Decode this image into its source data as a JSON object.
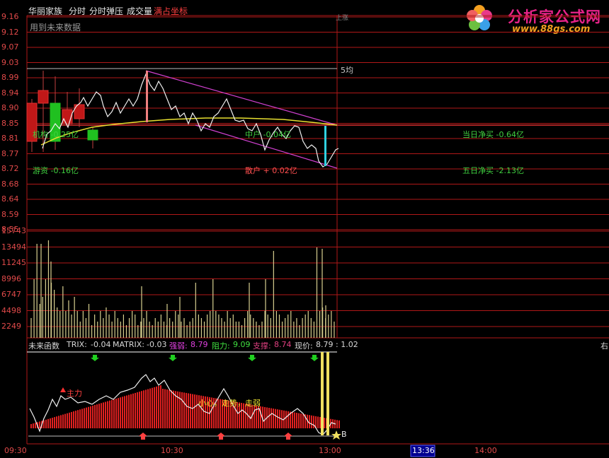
{
  "header": {
    "stock_name": "华丽家族",
    "menu": [
      "分时",
      "分时弹压",
      "成交量"
    ],
    "active_tag": "满占坐标",
    "future_data_hint": "用到未来数据"
  },
  "price_axis": [
    "9.16",
    "9.12",
    "9.07",
    "9.03",
    "8.99",
    "8.94",
    "8.90",
    "8.85",
    "8.81",
    "8.77",
    "8.72",
    "8.68",
    "8.64",
    "8.59",
    "8.55"
  ],
  "volume_axis": [
    "15743",
    "13494",
    "11245",
    "8996",
    "6747",
    "4498",
    "2249"
  ],
  "annotations": {
    "ma5": "5均",
    "jigou": "机构 -0.25亿",
    "youzi": "游资 -0.16亿",
    "zhonghu": "中户 -0.04亿",
    "sanhu": "散户 + 0.02亿",
    "today_net": "当日净买 -0.64亿",
    "five_day_net": "五日净买 -2.13亿",
    "top_right_small": "上涨"
  },
  "indicator": {
    "name": "未来函数",
    "trix_label": "TRIX:",
    "trix": "-0.04",
    "matrix_label": "MATRIX:",
    "matrix": "-0.03",
    "strong_label": "强弱:",
    "strong": "8.79",
    "resist_label": "阻力:",
    "resist": "9.09",
    "support_label": "支撑:",
    "support": "8.74",
    "price_label": "现价:",
    "price": "8.79",
    "ratio": ": 1.02",
    "right_cut": "右",
    "zhuli": "主力",
    "caution": "小心，走势，走弱",
    "buy_mark": "B"
  },
  "time_axis": {
    "t0": "09:30",
    "t1": "10:30",
    "t2": "13:00",
    "cursor": "13:36",
    "t3": "14:00"
  },
  "logo": {
    "title": "分析家公式网",
    "url": "www.88gs.com"
  },
  "colors": {
    "up": "#e03030",
    "down": "#20c020",
    "grid": "#b01818",
    "axis": "#e24a4a",
    "white": "#f0f0f0",
    "yellow": "#e8e030",
    "magenta": "#d040d0",
    "cyan": "#30d0e0"
  }
}
